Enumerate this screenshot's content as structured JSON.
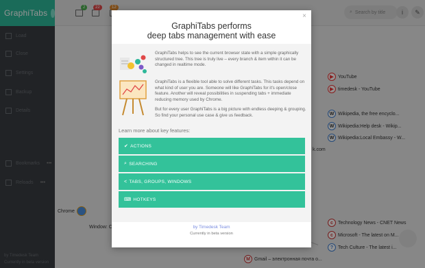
{
  "sidebar": {
    "logo_text": "GraphiTabs",
    "items": [
      {
        "label": "Load"
      },
      {
        "label": "Close"
      },
      {
        "label": "Settings"
      },
      {
        "label": "Backup"
      },
      {
        "label": "Details"
      },
      {
        "label": "Bookmarks"
      },
      {
        "label": "Reloads"
      }
    ],
    "footer": {
      "by": "by Timedesk Team",
      "beta": "Currently in beta version"
    }
  },
  "topbar": {
    "badges": [
      "2",
      "22",
      "12"
    ],
    "search_placeholder": "Search by title"
  },
  "graph": {
    "nodes": [
      {
        "label": "YouTube"
      },
      {
        "label": "timedesk - YouTube"
      },
      {
        "label": "Wikipedia, the free encyclo..."
      },
      {
        "label": "Wikipedia:Help desk - Wikip..."
      },
      {
        "label": "Wikipedia:Local Embassy - W..."
      },
      {
        "label": "Chrome"
      },
      {
        "label": "Window: C"
      },
      {
        "label": "k.com"
      },
      {
        "label": "Technology News - CNET News"
      },
      {
        "label": "Microsoft - The latest on M..."
      },
      {
        "label": "Tech Culture - The latest i..."
      },
      {
        "label": "Gmail – электронная почта о..."
      }
    ]
  },
  "modal": {
    "title_line1": "GraphiTabs performs",
    "title_line2": "deep tabs management with ease",
    "close_label": "×",
    "paragraph1": "GraphiTabs helps to see the current browser state with a simple graphically structured tree. This tree is truly live – every branch & item within it can be changed in realtime mode.",
    "paragraph2": "GraphiTabs is a flexible tool able to solve different tasks. This tasks depend on what kind of user you are. Someone will like GraphiTabs for it's open/close feature. Another will reveal possibilities in suspending tabs + immediate reducing memory used by Chrome.",
    "paragraph3": "But for every user GraphiTabs is a big picture with endless deeping & grouping. So find your personal use case & give us feedback.",
    "learn_more": "Learn more about key features:",
    "features": [
      {
        "icon": "✔",
        "label": "ACTIONS"
      },
      {
        "icon": "⌕",
        "label": "SEARCHING"
      },
      {
        "icon": "<",
        "label": "TABS, GROUPS, WINDOWS"
      },
      {
        "icon": "⌨",
        "label": "HOTKEYS"
      }
    ],
    "footer_by": "by Timedesk Team",
    "footer_beta": "Currently in beta version"
  },
  "colors": {
    "accent": "#33c29a",
    "sidebar_bg": "#3a3d42",
    "link": "#7a8de0"
  }
}
